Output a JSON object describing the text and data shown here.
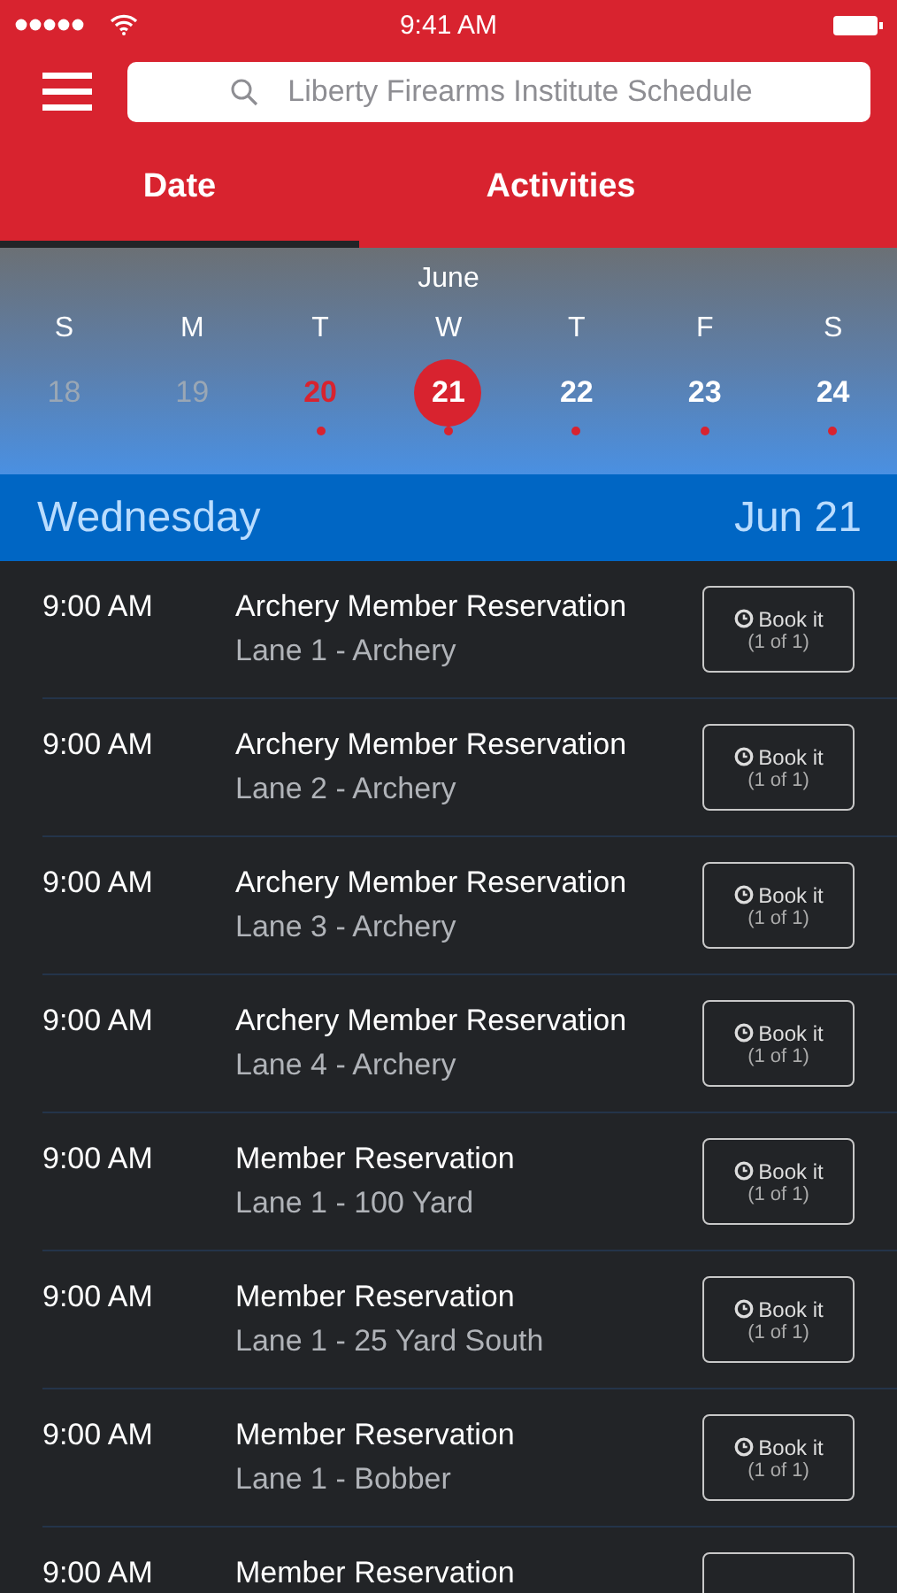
{
  "status_bar": {
    "time": "9:41 AM"
  },
  "search": {
    "placeholder": "Liberty Firearms Institute Schedule"
  },
  "tabs": [
    {
      "label": "Date",
      "selected": true
    },
    {
      "label": "Activities",
      "selected": false
    }
  ],
  "calendar": {
    "month": "June",
    "weekdays": [
      "S",
      "M",
      "T",
      "W",
      "T",
      "F",
      "S"
    ],
    "days": [
      {
        "label": "18",
        "past": true,
        "today": false,
        "selected": false,
        "has_events": false
      },
      {
        "label": "19",
        "past": true,
        "today": false,
        "selected": false,
        "has_events": false
      },
      {
        "label": "20",
        "past": false,
        "today": true,
        "selected": false,
        "has_events": true
      },
      {
        "label": "21",
        "past": false,
        "today": false,
        "selected": true,
        "has_events": true
      },
      {
        "label": "22",
        "past": false,
        "today": false,
        "selected": false,
        "has_events": true
      },
      {
        "label": "23",
        "past": false,
        "today": false,
        "selected": false,
        "has_events": true
      },
      {
        "label": "24",
        "past": false,
        "today": false,
        "selected": false,
        "has_events": true
      }
    ]
  },
  "day_header": {
    "weekday": "Wednesday",
    "date": "Jun 21"
  },
  "events": [
    {
      "time": "9:00 AM",
      "title": "Archery Member Reservation",
      "location": "Lane 1 - Archery",
      "button": "Book it",
      "availability": "(1 of 1)"
    },
    {
      "time": "9:00 AM",
      "title": "Archery Member Reservation",
      "location": "Lane 2 - Archery",
      "button": "Book it",
      "availability": "(1 of 1)"
    },
    {
      "time": "9:00 AM",
      "title": "Archery Member Reservation",
      "location": "Lane 3 - Archery",
      "button": "Book it",
      "availability": "(1 of 1)"
    },
    {
      "time": "9:00 AM",
      "title": "Archery Member Reservation",
      "location": "Lane 4 - Archery",
      "button": "Book it",
      "availability": "(1 of 1)"
    },
    {
      "time": "9:00 AM",
      "title": "Member Reservation",
      "location": "Lane 1 - 100 Yard",
      "button": "Book it",
      "availability": "(1 of 1)"
    },
    {
      "time": "9:00 AM",
      "title": "Member Reservation",
      "location": "Lane 1 - 25 Yard South",
      "button": "Book it",
      "availability": "(1 of 1)"
    },
    {
      "time": "9:00 AM",
      "title": "Member Reservation",
      "location": "Lane 1 - Bobber",
      "button": "Book it",
      "availability": "(1 of 1)"
    },
    {
      "time": "9:00 AM",
      "title": "Member Reservation"
    }
  ]
}
